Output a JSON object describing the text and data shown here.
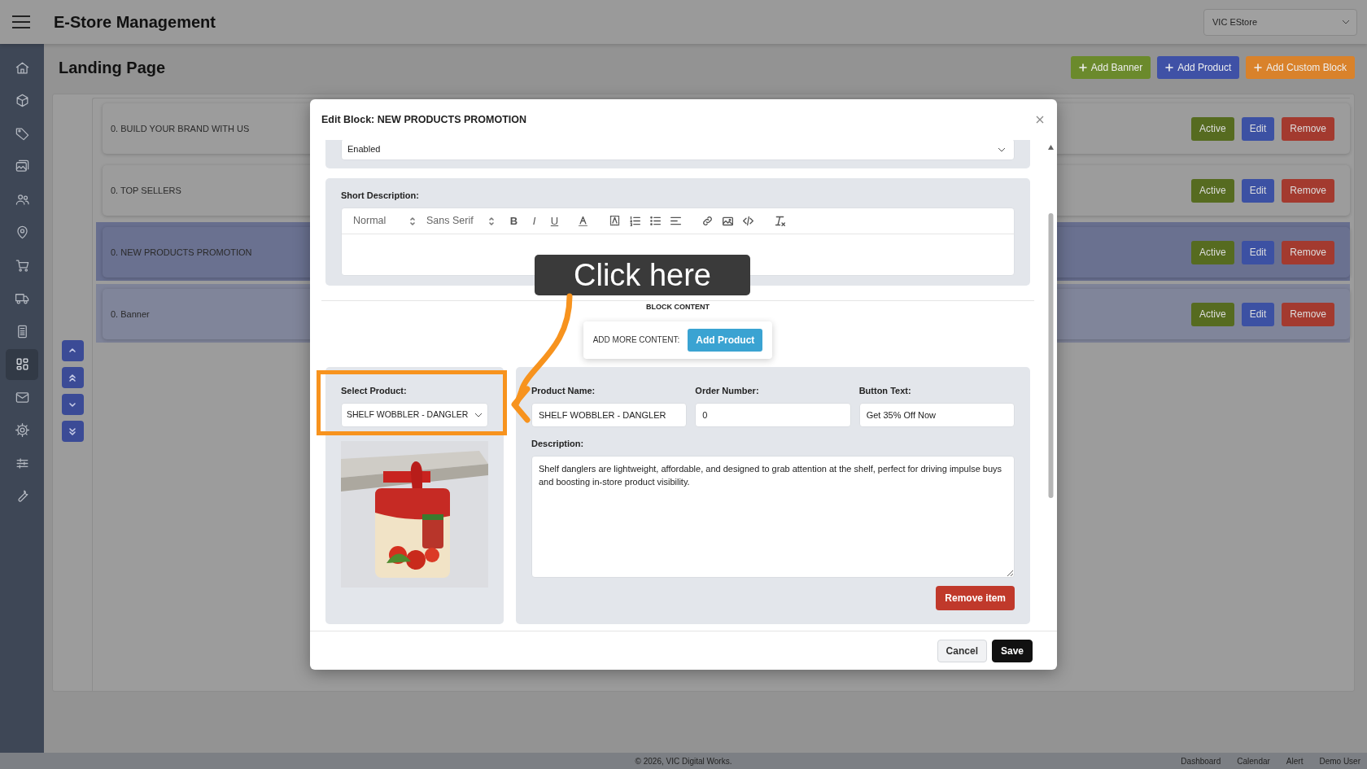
{
  "app": {
    "title": "E-Store Management",
    "store_select": "VIC EStore"
  },
  "sidebar": {
    "items": [
      {
        "selected": false
      },
      {
        "selected": false
      },
      {
        "selected": false
      },
      {
        "selected": false
      },
      {
        "selected": false
      },
      {
        "selected": false
      },
      {
        "selected": false
      },
      {
        "selected": false
      },
      {
        "selected": false
      },
      {
        "selected": true
      },
      {
        "selected": false
      },
      {
        "selected": false
      },
      {
        "selected": false
      },
      {
        "selected": false
      }
    ]
  },
  "page": {
    "title": "Landing Page",
    "actions": [
      {
        "label": "Add Banner",
        "color": "#6b8a2c"
      },
      {
        "label": "Add Product",
        "color": "#3f51a6"
      },
      {
        "label": "Add Custom Block",
        "color": "#d9822b"
      }
    ]
  },
  "blocks": [
    {
      "title": "0. BUILD YOUR BRAND WITH US",
      "selected": false,
      "hovered": false,
      "buttons": [
        "Active",
        "Edit",
        "Remove"
      ]
    },
    {
      "title": "0. TOP SELLERS",
      "selected": false,
      "hovered": false,
      "buttons": [
        "Active",
        "Edit",
        "Remove"
      ]
    },
    {
      "title": "0. NEW PRODUCTS PROMOTION",
      "selected": true,
      "hovered": false,
      "buttons": [
        "Active",
        "Edit",
        "Remove"
      ]
    },
    {
      "title": "0. Banner",
      "selected": false,
      "hovered": true,
      "buttons": [
        "Active",
        "Edit",
        "Remove"
      ]
    }
  ],
  "modal": {
    "title": "Edit Block: NEW PRODUCTS PROMOTION",
    "status_select": "Enabled",
    "short_description": {
      "label": "Short Description:",
      "header_picker": "Normal",
      "font_picker": "Sans Serif",
      "format_buttons": [
        "B",
        "I",
        "U"
      ]
    },
    "block_content_heading": "BLOCK CONTENT",
    "add_more": {
      "label": "ADD MORE CONTENT:",
      "button": "Add Product"
    },
    "item": {
      "select_label": "Select Product:",
      "select_value": "SHELF WOBBLER - DANGLER",
      "fields": [
        {
          "label": "Product Name:",
          "value": "SHELF WOBBLER - DANGLER"
        },
        {
          "label": "Order Number:",
          "value": "0"
        },
        {
          "label": "Button Text:",
          "value": "Get 35% Off Now"
        }
      ],
      "description_label": "Description:",
      "description": "Shelf danglers are lightweight, affordable, and designed to grab attention at the shelf, perfect for driving impulse buys and boosting in-store product visibility.",
      "remove_button": "Remove item"
    },
    "buttons": [
      "Cancel",
      "Save"
    ]
  },
  "annotation": {
    "tooltip": "Click here"
  },
  "footer": {
    "copyright": "© 2026, VIC Digital Works.",
    "links": [
      "Dashboard",
      "Calendar",
      "Alert",
      "Demo User"
    ]
  }
}
